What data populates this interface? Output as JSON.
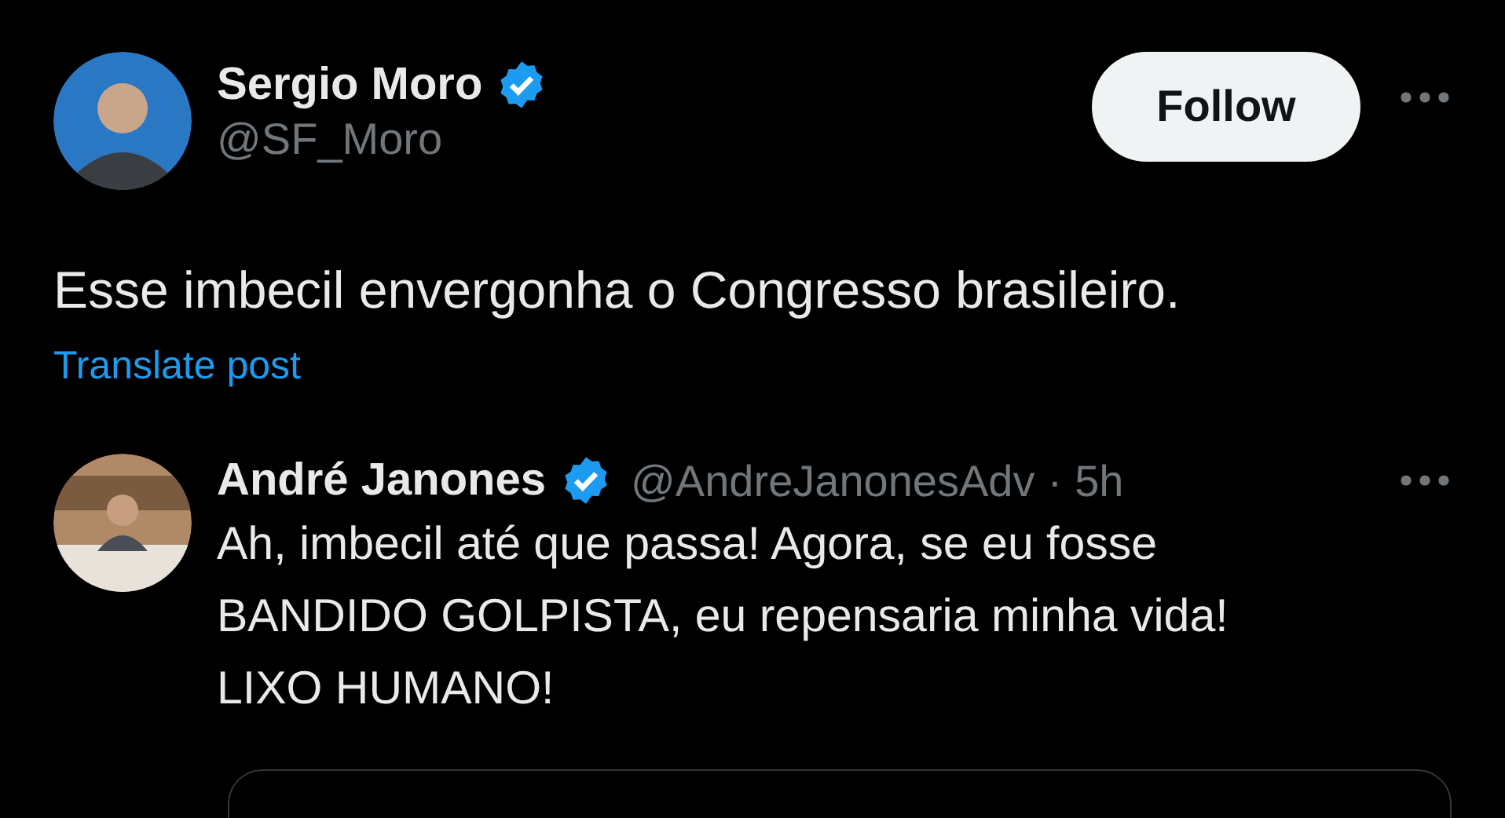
{
  "post": {
    "author": {
      "name": "Sergio Moro",
      "verified": true,
      "handle": "@SF_Moro"
    },
    "follow_button": "Follow",
    "text": "Esse imbecil envergonha o Congresso brasileiro.",
    "translate_link": "Translate post"
  },
  "reply": {
    "author": {
      "name": "André Janones",
      "verified": true,
      "handle": "@AndreJanonesAdv"
    },
    "separator": "·",
    "time": "5h",
    "text_lines": [
      "Ah, imbecil até que passa! Agora, se eu fosse",
      "BANDIDO GOLPISTA, eu repensaria minha vida!",
      "LIXO HUMANO!"
    ]
  }
}
